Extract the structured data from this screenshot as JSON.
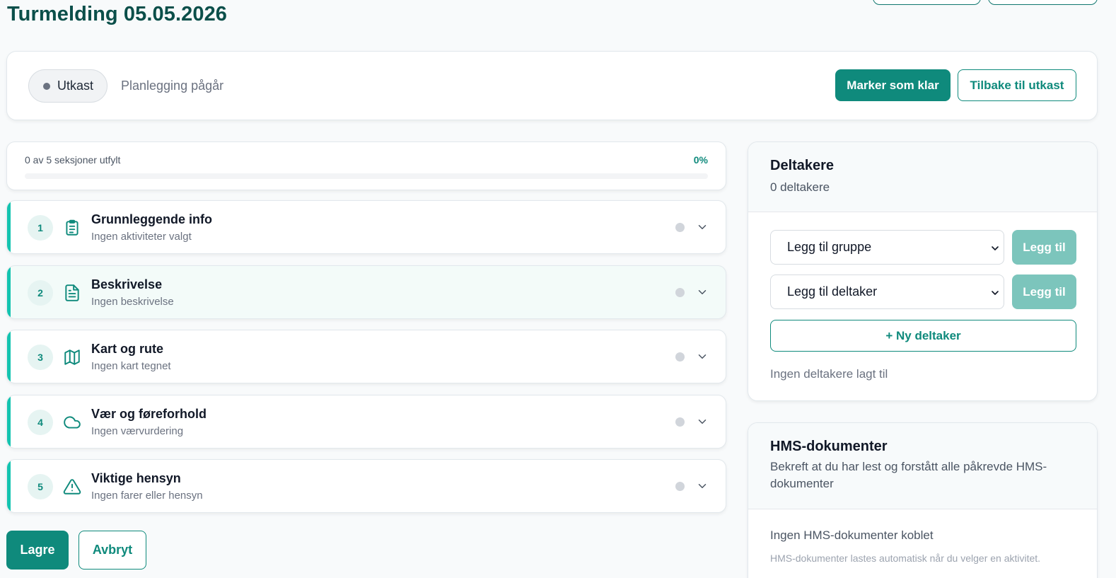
{
  "page": {
    "title": "Turmelding 05.05.2026"
  },
  "status": {
    "badge": "Utkast",
    "text": "Planlegging pågår",
    "mark_ready": "Marker som klar",
    "back_to_draft": "Tilbake til utkast"
  },
  "progress": {
    "label": "0 av 5 seksjoner utfylt",
    "percent_label": "0%",
    "fraction": 0
  },
  "sections": [
    {
      "num": "1",
      "title": "Grunnleggende info",
      "subtitle": "Ingen aktiviteter valgt",
      "icon": "clipboard-icon"
    },
    {
      "num": "2",
      "title": "Beskrivelse",
      "subtitle": "Ingen beskrivelse",
      "icon": "document-icon"
    },
    {
      "num": "3",
      "title": "Kart og rute",
      "subtitle": "Ingen kart tegnet",
      "icon": "map-icon"
    },
    {
      "num": "4",
      "title": "Vær og føreforhold",
      "subtitle": "Ingen værvurdering",
      "icon": "cloud-icon"
    },
    {
      "num": "5",
      "title": "Viktige hensyn",
      "subtitle": "Ingen farer eller hensyn",
      "icon": "warning-icon"
    }
  ],
  "actions": {
    "save": "Lagre",
    "cancel": "Avbryt"
  },
  "participants": {
    "title": "Deltakere",
    "count_text": "0 deltakere",
    "group_select": "Legg til gruppe",
    "participant_select": "Legg til deltaker",
    "add_label": "Legg til",
    "new_participant": "+ Ny deltaker",
    "empty": "Ingen deltakere lagt til"
  },
  "hms": {
    "title": "HMS-dokumenter",
    "subtitle": "Bekreft at du har lest og forstått alle påkrevde HMS-dokumenter",
    "empty": "Ingen HMS-dokumenter koblet",
    "note": "HMS-dokumenter lastes automatisk når du velger en aktivitet."
  },
  "colors": {
    "accent": "#0f8a7c",
    "title": "#0b4f4a",
    "section_bar": "#14c4b0",
    "disabled_button": "#7cc5bc"
  }
}
